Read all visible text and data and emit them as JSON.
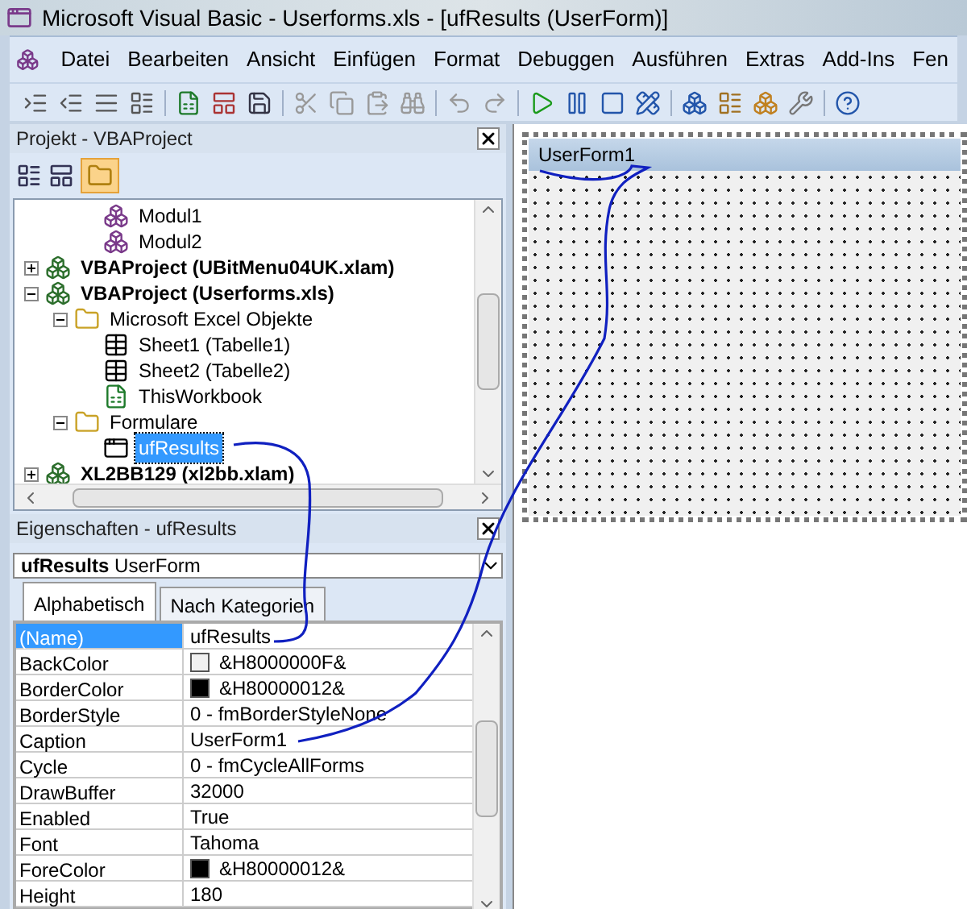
{
  "window": {
    "title": "Microsoft Visual Basic - Userforms.xls - [ufResults (UserForm)]"
  },
  "menu": [
    "Datei",
    "Bearbeiten",
    "Ansicht",
    "Einfügen",
    "Format",
    "Debuggen",
    "Ausführen",
    "Extras",
    "Add-Ins",
    "Fen"
  ],
  "project": {
    "title": "Projekt - VBAProject",
    "tree": [
      {
        "children": [
          {
            "label": "Modul1",
            "kind": "module",
            "bold": false,
            "selected": false
          },
          {
            "label": "Modul2",
            "kind": "module",
            "bold": false,
            "selected": false
          }
        ]
      },
      {
        "label": "VBAProject (UBitMenu04UK.xlam)",
        "kind": "project",
        "bold": true,
        "expanded": false,
        "selected": false
      },
      {
        "label": "VBAProject (Userforms.xls)",
        "kind": "project",
        "bold": true,
        "expanded": true,
        "selected": false,
        "children": [
          {
            "label": "Microsoft Excel Objekte",
            "kind": "folder",
            "bold": false,
            "expanded": true,
            "selected": false,
            "children": [
              {
                "label": "Sheet1 (Tabelle1)",
                "kind": "sheet",
                "bold": false,
                "selected": false
              },
              {
                "label": "Sheet2 (Tabelle2)",
                "kind": "sheet",
                "bold": false,
                "selected": false
              },
              {
                "label": "ThisWorkbook",
                "kind": "workbook",
                "bold": false,
                "selected": false
              }
            ]
          },
          {
            "label": "Formulare",
            "kind": "folder",
            "bold": false,
            "expanded": true,
            "selected": false,
            "children": [
              {
                "label": "ufResults",
                "kind": "form",
                "bold": false,
                "selected": true
              }
            ]
          }
        ]
      },
      {
        "label": "XL2BB129 (xl2bb.xlam)",
        "kind": "project",
        "bold": true,
        "expanded": false,
        "selected": false
      }
    ]
  },
  "properties": {
    "title": "Eigenschaften - ufResults",
    "object_name": "ufResults",
    "object_type": "UserForm",
    "tabs": [
      {
        "label": "Alphabetisch",
        "selected": true
      },
      {
        "label": "Nach Kategorien",
        "selected": false
      }
    ],
    "rows": [
      {
        "name": "(Name)",
        "value": "ufResults",
        "selected": true
      },
      {
        "name": "BackColor",
        "value": "&H8000000F&",
        "color": "#f0f0f0",
        "selected": false
      },
      {
        "name": "BorderColor",
        "value": "&H80000012&",
        "color": "#000000",
        "selected": false
      },
      {
        "name": "BorderStyle",
        "value": "0 - fmBorderStyleNone",
        "selected": false
      },
      {
        "name": "Caption",
        "value": "UserForm1",
        "selected": false
      },
      {
        "name": "Cycle",
        "value": "0 - fmCycleAllForms",
        "selected": false
      },
      {
        "name": "DrawBuffer",
        "value": "32000",
        "selected": false
      },
      {
        "name": "Enabled",
        "value": "True",
        "selected": false
      },
      {
        "name": "Font",
        "value": "Tahoma",
        "selected": false
      },
      {
        "name": "ForeColor",
        "value": "&H80000012&",
        "color": "#000000",
        "selected": false
      },
      {
        "name": "Height",
        "value": "180",
        "selected": false
      }
    ]
  },
  "form": {
    "caption": "UserForm1"
  }
}
